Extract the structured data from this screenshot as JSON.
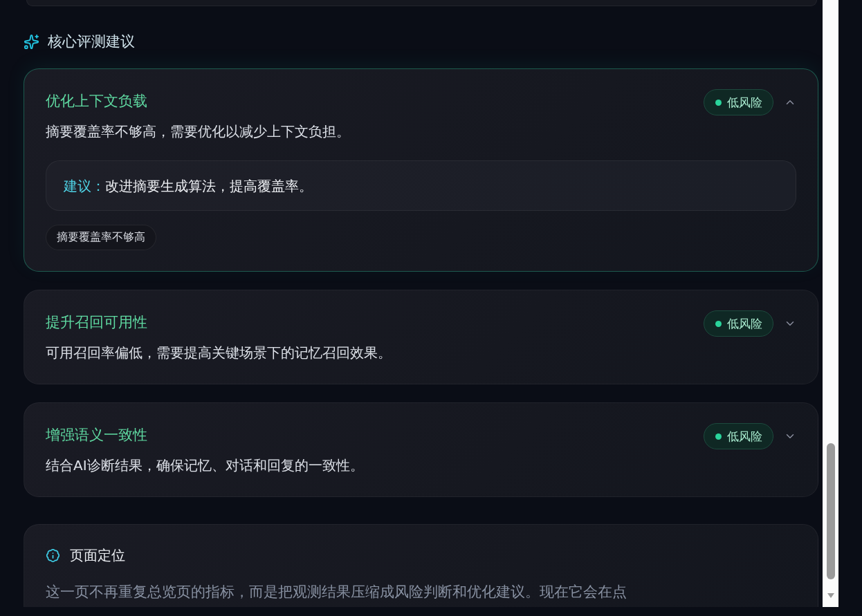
{
  "section": {
    "title": "核心评测建议"
  },
  "recommendations": [
    {
      "title": "优化上下文负载",
      "risk": "低风险",
      "expanded": true,
      "description": "摘要覆盖率不够高，需要优化以减少上下文负担。",
      "suggestion_label": "建议：",
      "suggestion": "改进摘要生成算法，提高覆盖率。",
      "tags": [
        "摘要覆盖率不够高"
      ]
    },
    {
      "title": "提升召回可用性",
      "risk": "低风险",
      "expanded": false,
      "description": "可用召回率偏低，需要提高关键场景下的记忆召回效果。"
    },
    {
      "title": "增强语义一致性",
      "risk": "低风险",
      "expanded": false,
      "description": "结合AI诊断结果，确保记忆、对话和回复的一致性。"
    }
  ],
  "info_panel": {
    "title": "页面定位",
    "text": "这一页不再重复总览页的指标，而是把观测结果压缩成风险判断和优化建议。现在它会在点"
  }
}
